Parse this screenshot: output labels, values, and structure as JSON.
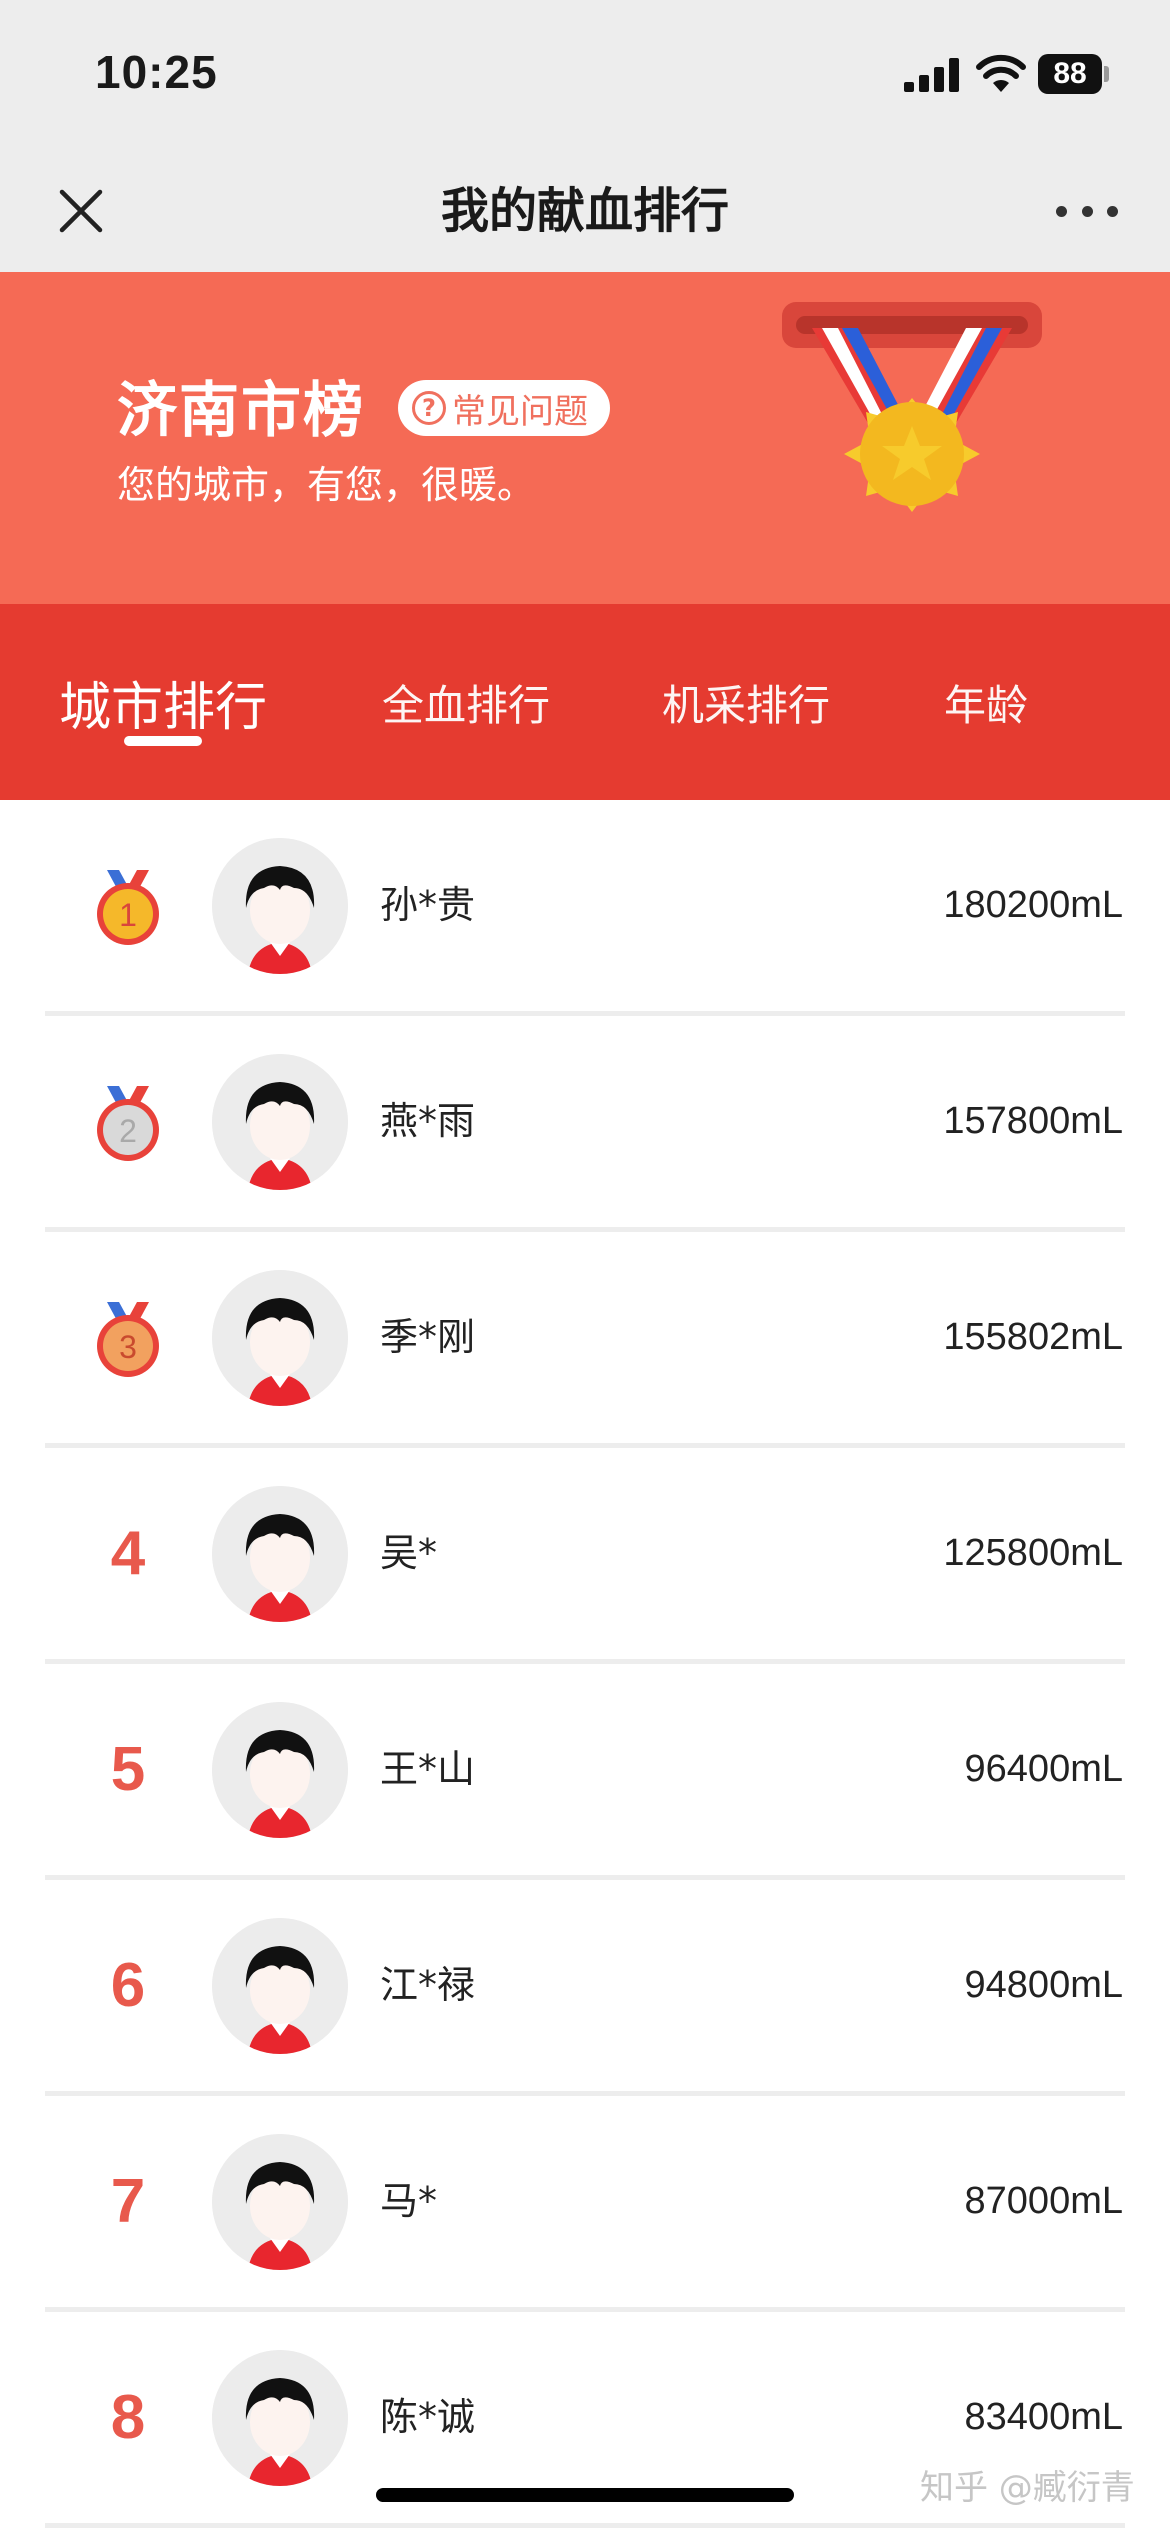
{
  "status_bar": {
    "time": "10:25",
    "battery": "88"
  },
  "nav": {
    "title": "我的献血排行",
    "close_icon": "close-icon",
    "more_icon": "more-icon"
  },
  "banner": {
    "title": "济南市榜",
    "faq_label": "常见问题",
    "faq_icon": "?",
    "subtitle": "您的城市，有您，很暖。",
    "background": "#f56a55"
  },
  "tabs": [
    {
      "label": "城市排行",
      "active": true
    },
    {
      "label": "全血排行",
      "active": false
    },
    {
      "label": "机采排行",
      "active": false
    },
    {
      "label": "年龄",
      "active": false
    }
  ],
  "tabs_background": "#e53b30",
  "ranking": [
    {
      "rank": "1",
      "name": "孙*贵",
      "amount": "180200mL",
      "medal": "gold"
    },
    {
      "rank": "2",
      "name": "燕*雨",
      "amount": "157800mL",
      "medal": "silver"
    },
    {
      "rank": "3",
      "name": "季*刚",
      "amount": "155802mL",
      "medal": "bronze"
    },
    {
      "rank": "4",
      "name": "吴*",
      "amount": "125800mL"
    },
    {
      "rank": "5",
      "name": "王*山",
      "amount": "96400mL"
    },
    {
      "rank": "6",
      "name": "江*禄",
      "amount": "94800mL"
    },
    {
      "rank": "7",
      "name": "马*",
      "amount": "87000mL"
    },
    {
      "rank": "8",
      "name": "陈*诚",
      "amount": "83400mL"
    }
  ],
  "watermark": "知乎 @臧衍青"
}
